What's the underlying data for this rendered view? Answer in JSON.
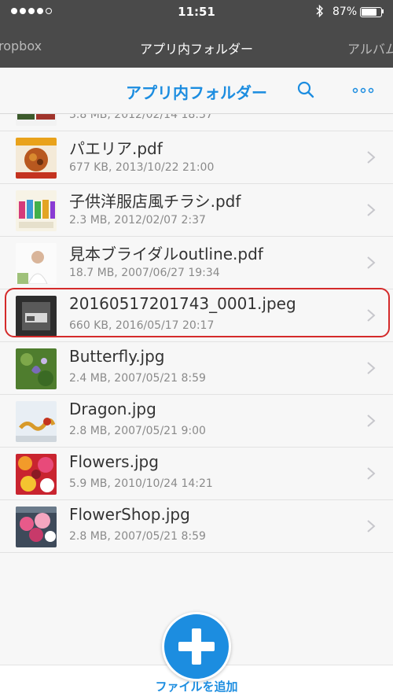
{
  "status_bar": {
    "time": "11:51",
    "battery_percent": "87%",
    "battery_level": 0.87,
    "signal_bars_filled": 4,
    "signal_bars_total": 5,
    "bluetooth_icon": "bluetooth-icon"
  },
  "tabs": {
    "left_label": "ropbox",
    "center_label": "アプリ内フォルダー",
    "right_label": "アルバム"
  },
  "nav": {
    "title": "アプリ内フォルダー",
    "search_icon": "search-icon",
    "more_icon": "more-icon"
  },
  "files": [
    {
      "name": "",
      "meta": "3.8 MB, 2012/02/14 18:37",
      "thumb": "flyer"
    },
    {
      "name": "パエリア.pdf",
      "meta": "677 KB, 2013/10/22 21:00",
      "thumb": "paella"
    },
    {
      "name": "子供洋服店風チラシ.pdf",
      "meta": "2.3 MB, 2012/02/07 2:37",
      "thumb": "kids"
    },
    {
      "name": "見本ブライダルoutline.pdf",
      "meta": "18.7 MB, 2007/06/27 19:34",
      "thumb": "bridal"
    },
    {
      "name": "20160517201743_0001.jpeg",
      "meta": "660 KB, 2016/05/17 20:17",
      "thumb": "scan"
    },
    {
      "name": "Butterfly.jpg",
      "meta": "2.4 MB, 2007/05/21 8:59",
      "thumb": "butterfly"
    },
    {
      "name": "Dragon.jpg",
      "meta": "2.8 MB, 2007/05/21 9:00",
      "thumb": "dragon"
    },
    {
      "name": "Flowers.jpg",
      "meta": "5.9 MB, 2010/10/24 14:21",
      "thumb": "flowers"
    },
    {
      "name": "FlowerShop.jpg",
      "meta": "2.8 MB, 2007/05/21 8:59",
      "thumb": "flowershop"
    }
  ],
  "bottom": {
    "add_label": "ファイルを追加",
    "add_icon": "plus-icon"
  },
  "colors": {
    "accent": "#1c8de0",
    "header_bg": "#4a4a4a",
    "highlight": "#d42a2a"
  }
}
